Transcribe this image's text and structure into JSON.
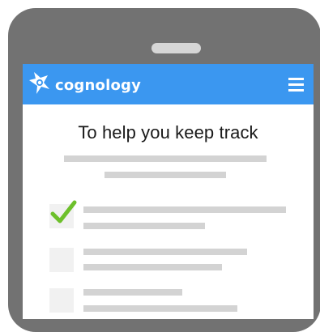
{
  "app": {
    "brand": "cognology",
    "brand_color": "#3b97f0",
    "menu_icon": "hamburger-menu-icon"
  },
  "screen": {
    "title": "To help you keep track",
    "checklist": [
      {
        "checked": true
      },
      {
        "checked": false
      },
      {
        "checked": false
      }
    ]
  }
}
